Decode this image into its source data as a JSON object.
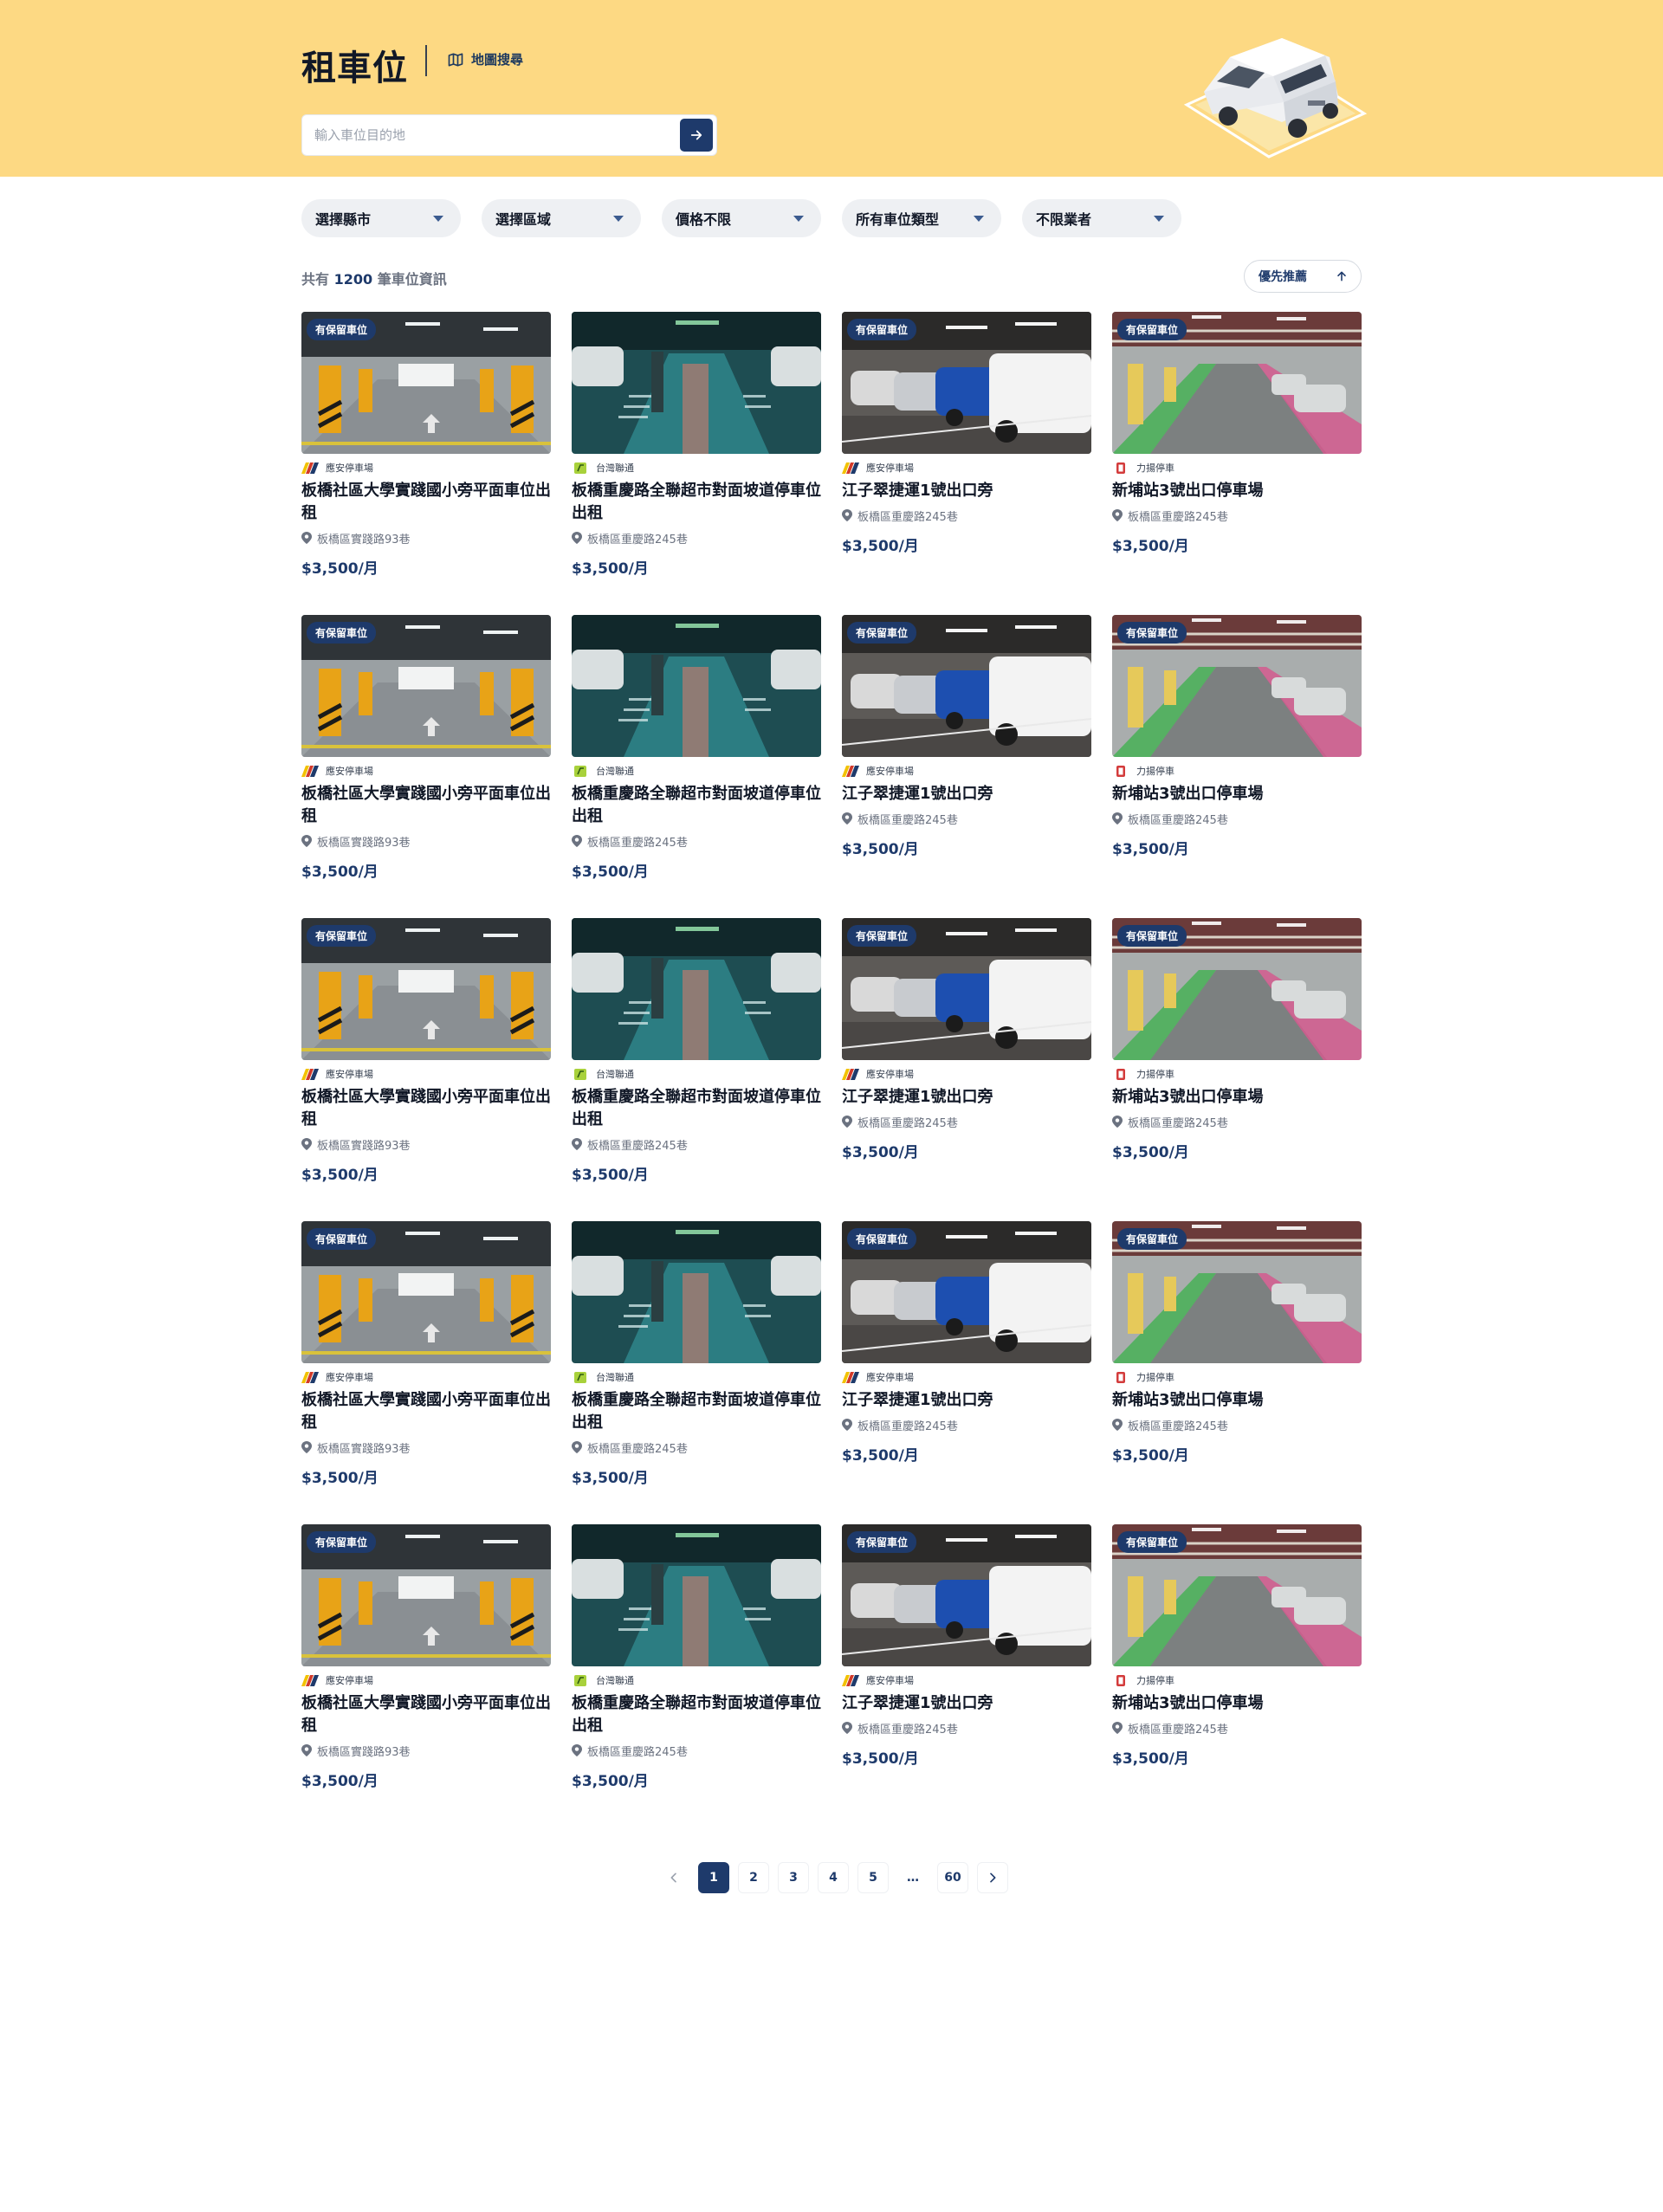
{
  "header": {
    "title": "租車位",
    "map_search_label": "地圖搜尋",
    "search_placeholder": "輸入車位目的地"
  },
  "filters": [
    "選擇縣市",
    "選擇區域",
    "價格不限",
    "所有車位類型",
    "不限業者"
  ],
  "results": {
    "prefix": "共有",
    "count": "1200",
    "suffix": "筆車位資訊",
    "sort_label": "優先推薦"
  },
  "badge_label": "有保留車位",
  "colors": {
    "accent": "#1e3a6b",
    "hero_bg": "#fdd983"
  },
  "listings": [
    {
      "badge": true,
      "operator": "應安停車場",
      "operator_logo": "stripes-logo",
      "title": "板橋社區大學實踐國小旁平面車位出租",
      "address": "板橋區實踐路93巷",
      "price": "$3,500/月",
      "photo": "garage-yellow"
    },
    {
      "badge": false,
      "operator": "台灣聯通",
      "operator_logo": "lime-logo",
      "title": "板橋重慶路全聯超市對面坡道停車位出租",
      "address": "板橋區重慶路245巷",
      "price": "$3,500/月",
      "photo": "garage-teal"
    },
    {
      "badge": true,
      "operator": "應安停車場",
      "operator_logo": "stripes-logo",
      "title": "江子翠捷運1號出口旁",
      "address": "板橋區重慶路245巷",
      "price": "$3,500/月",
      "photo": "garage-vans"
    },
    {
      "badge": true,
      "operator": "力揚停車",
      "operator_logo": "red-logo",
      "title": "新埔站3號出口停車場",
      "address": "板橋區重慶路245巷",
      "price": "$3,500/月",
      "photo": "garage-green"
    },
    {
      "badge": true,
      "operator": "應安停車場",
      "operator_logo": "stripes-logo",
      "title": "板橋社區大學實踐國小旁平面車位出租",
      "address": "板橋區實踐路93巷",
      "price": "$3,500/月",
      "photo": "garage-yellow"
    },
    {
      "badge": false,
      "operator": "台灣聯通",
      "operator_logo": "lime-logo",
      "title": "板橋重慶路全聯超市對面坡道停車位出租",
      "address": "板橋區重慶路245巷",
      "price": "$3,500/月",
      "photo": "garage-teal"
    },
    {
      "badge": true,
      "operator": "應安停車場",
      "operator_logo": "stripes-logo",
      "title": "江子翠捷運1號出口旁",
      "address": "板橋區重慶路245巷",
      "price": "$3,500/月",
      "photo": "garage-vans"
    },
    {
      "badge": true,
      "operator": "力揚停車",
      "operator_logo": "red-logo",
      "title": "新埔站3號出口停車場",
      "address": "板橋區重慶路245巷",
      "price": "$3,500/月",
      "photo": "garage-green"
    },
    {
      "badge": true,
      "operator": "應安停車場",
      "operator_logo": "stripes-logo",
      "title": "板橋社區大學實踐國小旁平面車位出租",
      "address": "板橋區實踐路93巷",
      "price": "$3,500/月",
      "photo": "garage-yellow"
    },
    {
      "badge": false,
      "operator": "台灣聯通",
      "operator_logo": "lime-logo",
      "title": "板橋重慶路全聯超市對面坡道停車位出租",
      "address": "板橋區重慶路245巷",
      "price": "$3,500/月",
      "photo": "garage-teal"
    },
    {
      "badge": true,
      "operator": "應安停車場",
      "operator_logo": "stripes-logo",
      "title": "江子翠捷運1號出口旁",
      "address": "板橋區重慶路245巷",
      "price": "$3,500/月",
      "photo": "garage-vans"
    },
    {
      "badge": true,
      "operator": "力揚停車",
      "operator_logo": "red-logo",
      "title": "新埔站3號出口停車場",
      "address": "板橋區重慶路245巷",
      "price": "$3,500/月",
      "photo": "garage-green"
    },
    {
      "badge": true,
      "operator": "應安停車場",
      "operator_logo": "stripes-logo",
      "title": "板橋社區大學實踐國小旁平面車位出租",
      "address": "板橋區實踐路93巷",
      "price": "$3,500/月",
      "photo": "garage-yellow"
    },
    {
      "badge": false,
      "operator": "台灣聯通",
      "operator_logo": "lime-logo",
      "title": "板橋重慶路全聯超市對面坡道停車位出租",
      "address": "板橋區重慶路245巷",
      "price": "$3,500/月",
      "photo": "garage-teal"
    },
    {
      "badge": true,
      "operator": "應安停車場",
      "operator_logo": "stripes-logo",
      "title": "江子翠捷運1號出口旁",
      "address": "板橋區重慶路245巷",
      "price": "$3,500/月",
      "photo": "garage-vans"
    },
    {
      "badge": true,
      "operator": "力揚停車",
      "operator_logo": "red-logo",
      "title": "新埔站3號出口停車場",
      "address": "板橋區重慶路245巷",
      "price": "$3,500/月",
      "photo": "garage-green"
    },
    {
      "badge": true,
      "operator": "應安停車場",
      "operator_logo": "stripes-logo",
      "title": "板橋社區大學實踐國小旁平面車位出租",
      "address": "板橋區實踐路93巷",
      "price": "$3,500/月",
      "photo": "garage-yellow"
    },
    {
      "badge": false,
      "operator": "台灣聯通",
      "operator_logo": "lime-logo",
      "title": "板橋重慶路全聯超市對面坡道停車位出租",
      "address": "板橋區重慶路245巷",
      "price": "$3,500/月",
      "photo": "garage-teal"
    },
    {
      "badge": true,
      "operator": "應安停車場",
      "operator_logo": "stripes-logo",
      "title": "江子翠捷運1號出口旁",
      "address": "板橋區重慶路245巷",
      "price": "$3,500/月",
      "photo": "garage-vans"
    },
    {
      "badge": true,
      "operator": "力揚停車",
      "operator_logo": "red-logo",
      "title": "新埔站3號出口停車場",
      "address": "板橋區重慶路245巷",
      "price": "$3,500/月",
      "photo": "garage-green"
    }
  ],
  "pagination": {
    "pages": [
      "1",
      "2",
      "3",
      "4",
      "5"
    ],
    "ellipsis": "…",
    "last": "60",
    "current": "1"
  }
}
